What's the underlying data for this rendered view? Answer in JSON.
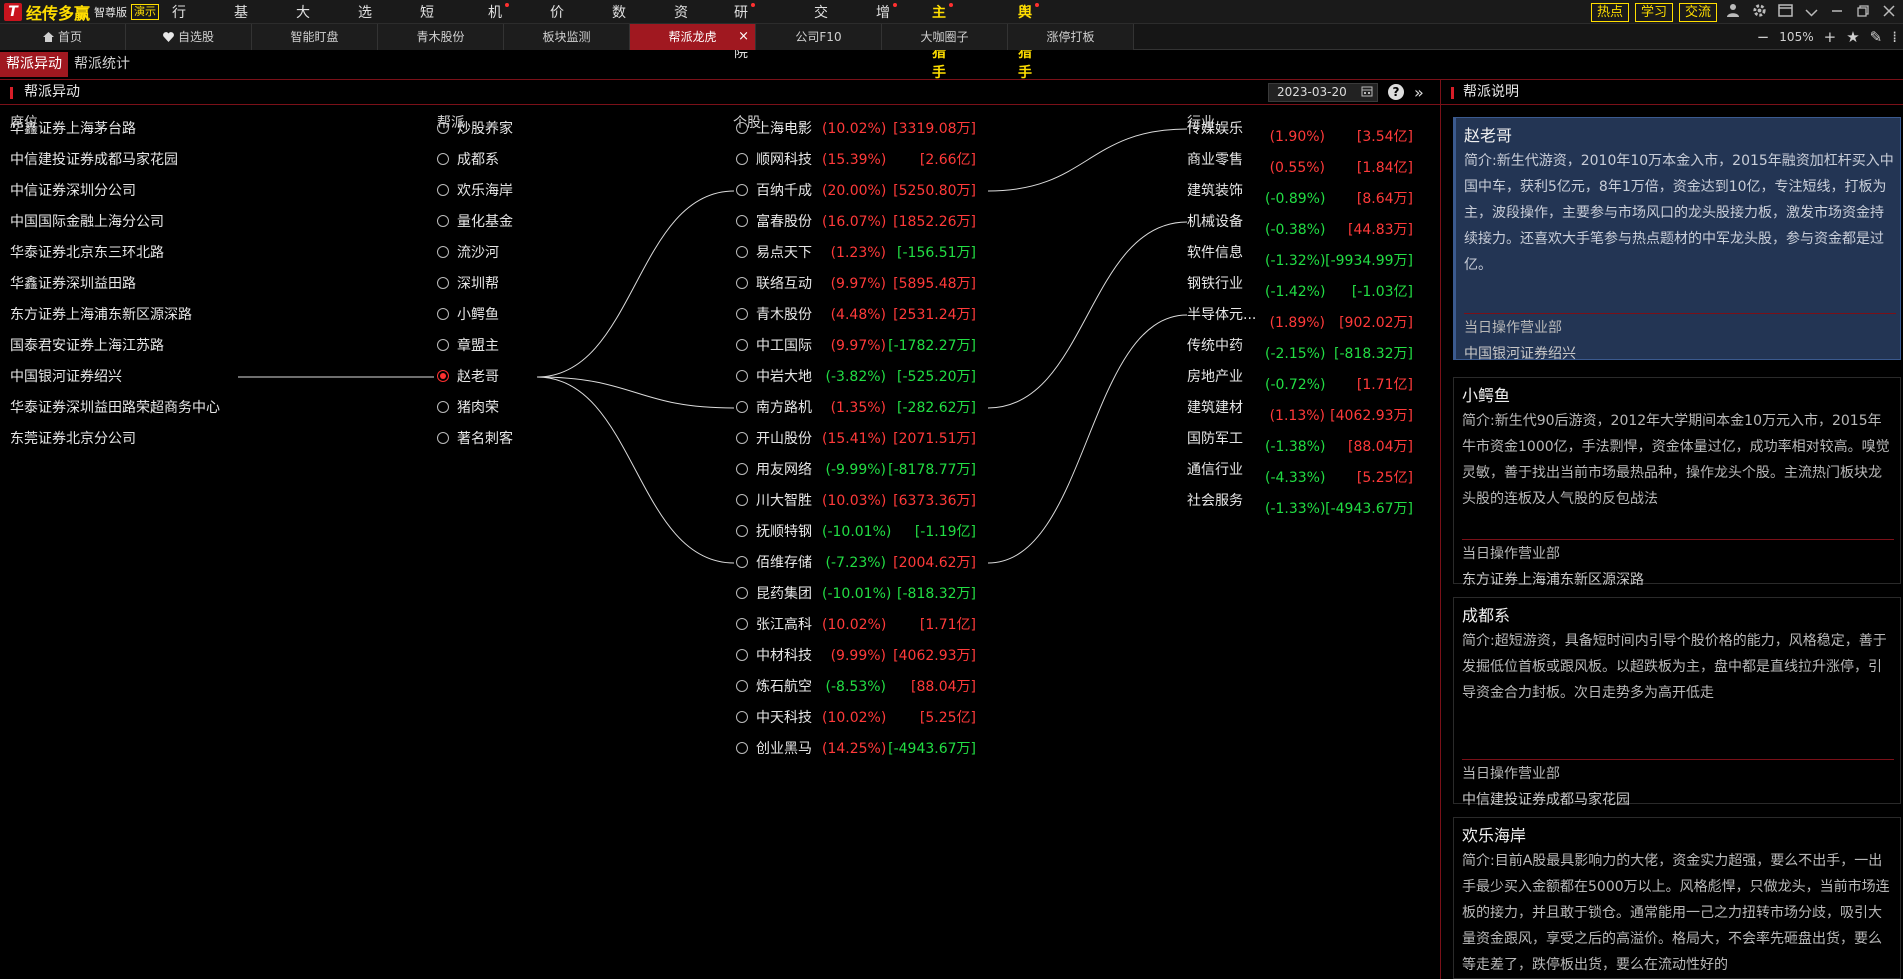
{
  "app": {
    "logo_mark": "T",
    "name": "经传多赢",
    "edition": "智尊版",
    "demo": "演示"
  },
  "menu": [
    {
      "label": "行情",
      "dot": false,
      "hot": false
    },
    {
      "label": "基金",
      "dot": false,
      "hot": false
    },
    {
      "label": "大盘",
      "dot": false,
      "hot": false
    },
    {
      "label": "选股",
      "dot": false,
      "hot": false
    },
    {
      "label": "短打",
      "dot": false,
      "hot": false
    },
    {
      "label": "机构",
      "dot": true,
      "hot": false
    },
    {
      "label": "价投",
      "dot": false,
      "hot": false
    },
    {
      "label": "数据",
      "dot": false,
      "hot": false
    },
    {
      "label": "资讯",
      "dot": false,
      "hot": false
    },
    {
      "label": "研究院",
      "dot": true,
      "hot": false
    },
    {
      "label": "交易",
      "dot": false,
      "hot": false
    },
    {
      "label": "增值",
      "dot": true,
      "hot": false
    },
    {
      "label": "主题猎手",
      "dot": true,
      "hot": true
    },
    {
      "label": "舆情猎手",
      "dot": true,
      "hot": true
    }
  ],
  "topright": {
    "hot": "热点",
    "learn": "学习",
    "exchange": "交流",
    "icons": [
      "user-icon",
      "settings-icon",
      "window-icon",
      "chevron-down-icon",
      "minimize-icon",
      "restore-icon",
      "close-icon"
    ]
  },
  "tabs": [
    {
      "label": "首页",
      "icon": "home-icon"
    },
    {
      "label": "自选股",
      "icon": "heart-icon"
    },
    {
      "label": "智能盯盘"
    },
    {
      "label": "青木股份"
    },
    {
      "label": "板块监测"
    },
    {
      "label": "帮派龙虎",
      "active": true,
      "close": "×"
    },
    {
      "label": "公司F10"
    },
    {
      "label": "大咖圈子"
    },
    {
      "label": "涨停打板"
    }
  ],
  "zoom": {
    "minus": "−",
    "value": "105%",
    "plus": "+"
  },
  "subtabs": [
    {
      "label": "帮派异动",
      "active": true
    },
    {
      "label": "帮派统计",
      "active": false
    }
  ],
  "left_panel": {
    "title": "帮派异动",
    "date": "2023-03-20",
    "help": "?",
    "more": "»",
    "headers": {
      "seat": "席位",
      "gang": "帮派",
      "stock": "个股",
      "industry": "行业"
    }
  },
  "seats": [
    "华鑫证券上海茅台路",
    "中信建投证券成都马家花园",
    "中信证券深圳分公司",
    "中国国际金融上海分公司",
    "华泰证券北京东三环北路",
    "华鑫证券深圳益田路",
    "东方证券上海浦东新区源深路",
    "国泰君安证券上海江苏路",
    "中国银河证券绍兴",
    "华泰证券深圳益田路荣超商务中心",
    "东莞证券北京分公司"
  ],
  "gangs": [
    {
      "name": "炒股养家",
      "selected": false
    },
    {
      "name": "成都系",
      "selected": false
    },
    {
      "name": "欢乐海岸",
      "selected": false
    },
    {
      "name": "量化基金",
      "selected": false
    },
    {
      "name": "流沙河",
      "selected": false
    },
    {
      "name": "深圳帮",
      "selected": false
    },
    {
      "name": "小鳄鱼",
      "selected": false
    },
    {
      "name": "章盟主",
      "selected": false
    },
    {
      "name": "赵老哥",
      "selected": true
    },
    {
      "name": "猪肉荣",
      "selected": false
    },
    {
      "name": "著名刺客",
      "selected": false
    }
  ],
  "stocks": [
    {
      "name": "上海电影",
      "pct": "(10.02%)",
      "pct_up": true,
      "amt": "[3319.08万]",
      "amt_up": true
    },
    {
      "name": "顺网科技",
      "pct": "(15.39%)",
      "pct_up": true,
      "amt": "[2.66亿]",
      "amt_up": true
    },
    {
      "name": "百纳千成",
      "pct": "(20.00%)",
      "pct_up": true,
      "amt": "[5250.80万]",
      "amt_up": true
    },
    {
      "name": "富春股份",
      "pct": "(16.07%)",
      "pct_up": true,
      "amt": "[1852.26万]",
      "amt_up": true
    },
    {
      "name": "易点天下",
      "pct": "(1.23%)",
      "pct_up": true,
      "amt": "[-156.51万]",
      "amt_up": false
    },
    {
      "name": "联络互动",
      "pct": "(9.97%)",
      "pct_up": true,
      "amt": "[5895.48万]",
      "amt_up": true
    },
    {
      "name": "青木股份",
      "pct": "(4.48%)",
      "pct_up": true,
      "amt": "[2531.24万]",
      "amt_up": true
    },
    {
      "name": "中工国际",
      "pct": "(9.97%)",
      "pct_up": true,
      "amt": "[-1782.27万]",
      "amt_up": false
    },
    {
      "name": "中岩大地",
      "pct": "(-3.82%)",
      "pct_up": false,
      "amt": "[-525.20万]",
      "amt_up": false
    },
    {
      "name": "南方路机",
      "pct": "(1.35%)",
      "pct_up": true,
      "amt": "[-282.62万]",
      "amt_up": false
    },
    {
      "name": "开山股份",
      "pct": "(15.41%)",
      "pct_up": true,
      "amt": "[2071.51万]",
      "amt_up": true
    },
    {
      "name": "用友网络",
      "pct": "(-9.99%)",
      "pct_up": false,
      "amt": "[-8178.77万]",
      "amt_up": false
    },
    {
      "name": "川大智胜",
      "pct": "(10.03%)",
      "pct_up": true,
      "amt": "[6373.36万]",
      "amt_up": true
    },
    {
      "name": "抚顺特钢",
      "pct": "(-10.01%)",
      "pct_up": false,
      "amt": "[-1.19亿]",
      "amt_up": false
    },
    {
      "name": "佰维存储",
      "pct": "(-7.23%)",
      "pct_up": false,
      "amt": "[2004.62万]",
      "amt_up": true
    },
    {
      "name": "昆药集团",
      "pct": "(-10.01%)",
      "pct_up": false,
      "amt": "[-818.32万]",
      "amt_up": false
    },
    {
      "name": "张江高科",
      "pct": "(10.02%)",
      "pct_up": true,
      "amt": "[1.71亿]",
      "amt_up": true
    },
    {
      "name": "中材科技",
      "pct": "(9.99%)",
      "pct_up": true,
      "amt": "[4062.93万]",
      "amt_up": true
    },
    {
      "name": "炼石航空",
      "pct": "(-8.53%)",
      "pct_up": false,
      "amt": "[88.04万]",
      "amt_up": true
    },
    {
      "name": "中天科技",
      "pct": "(10.02%)",
      "pct_up": true,
      "amt": "[5.25亿]",
      "amt_up": true
    },
    {
      "name": "创业黑马",
      "pct": "(14.25%)",
      "pct_up": true,
      "amt": "[-4943.67万]",
      "amt_up": false
    }
  ],
  "industries": [
    {
      "name": "传媒娱乐",
      "pct": "(1.90%)",
      "pct_up": true,
      "amt": "[3.54亿]",
      "amt_up": true
    },
    {
      "name": "商业零售",
      "pct": "(0.55%)",
      "pct_up": true,
      "amt": "[1.84亿]",
      "amt_up": true
    },
    {
      "name": "建筑装饰",
      "pct": "(-0.89%)",
      "pct_up": false,
      "amt": "[8.64万]",
      "amt_up": true
    },
    {
      "name": "机械设备",
      "pct": "(-0.38%)",
      "pct_up": false,
      "amt": "[44.83万]",
      "amt_up": true
    },
    {
      "name": "软件信息",
      "pct": "(-1.32%)",
      "pct_up": false,
      "amt": "[-9934.99万]",
      "amt_up": false
    },
    {
      "name": "钢铁行业",
      "pct": "(-1.42%)",
      "pct_up": false,
      "amt": "[-1.03亿]",
      "amt_up": false
    },
    {
      "name": "半导体元...",
      "pct": "(1.89%)",
      "pct_up": true,
      "amt": "[902.02万]",
      "amt_up": true
    },
    {
      "name": "传统中药",
      "pct": "(-2.15%)",
      "pct_up": false,
      "amt": "[-818.32万]",
      "amt_up": false
    },
    {
      "name": "房地产业",
      "pct": "(-0.72%)",
      "pct_up": false,
      "amt": "[1.71亿]",
      "amt_up": true
    },
    {
      "name": "建筑建材",
      "pct": "(1.13%)",
      "pct_up": true,
      "amt": "[4062.93万]",
      "amt_up": true
    },
    {
      "name": "国防军工",
      "pct": "(-1.38%)",
      "pct_up": false,
      "amt": "[88.04万]",
      "amt_up": true
    },
    {
      "name": "通信行业",
      "pct": "(-4.33%)",
      "pct_up": false,
      "amt": "[5.25亿]",
      "amt_up": true
    },
    {
      "name": "社会服务",
      "pct": "(-1.33%)",
      "pct_up": false,
      "amt": "[-4943.67万]",
      "amt_up": false
    }
  ],
  "links": {
    "seat_to_gang": [
      [
        8,
        8
      ]
    ],
    "gang_to_stock": [
      [
        8,
        2
      ],
      [
        8,
        9
      ],
      [
        8,
        14
      ]
    ],
    "stock_to_industry": [
      [
        2,
        0
      ],
      [
        9,
        3
      ],
      [
        14,
        6
      ]
    ]
  },
  "right_panel": {
    "title": "帮派说明",
    "op_label": "当日操作营业部",
    "cards": [
      {
        "name": "赵老哥",
        "selected": true,
        "desc": "简介:新生代游资，2010年10万本金入市，2015年融资加杠杆买入中国中车，获利5亿元，8年1万倍，资金达到10亿，专注短线，打板为主，波段操作，主要参与市场风口的龙头股接力板，激发市场资金持续接力。还喜欢大手笔参与热点题材的中军龙头股，参与资金都是过亿。",
        "op": "中国银河证券绍兴"
      },
      {
        "name": "小鳄鱼",
        "selected": false,
        "desc": "简介:新生代90后游资，2012年大学期间本金10万元入市，2015年牛市资金1000亿，手法剽悍，资金体量过亿，成功率相对较高。嗅觉灵敏，善于找出当前市场最热品种，操作龙头个股。主流热门板块龙头股的连板及人气股的反包战法",
        "op": "东方证券上海浦东新区源深路"
      },
      {
        "name": "成都系",
        "selected": false,
        "desc": "简介:超短游资，具备短时间内引导个股价格的能力，风格稳定，善于发掘低位首板或跟风板。以超跌板为主，盘中都是直线拉升涨停，引导资金合力封板。次日走势多为高开低走",
        "op": "中信建投证券成都马家花园"
      },
      {
        "name": "欢乐海岸",
        "selected": false,
        "desc": "简介:目前A股最具影响力的大佬，资金实力超强，要么不出手，一出手最少买入金额都在5000万以上。风格彪悍，只做龙头，当前市场连板的接力，并且敢于锁仓。通常能用一己之力扭转市场分歧，吸引大量资金跟风，享受之后的高溢价。格局大，不会率先砸盘出货，要么等走差了，跌停板出货，要么在流动性好的",
        "op": ""
      }
    ]
  }
}
